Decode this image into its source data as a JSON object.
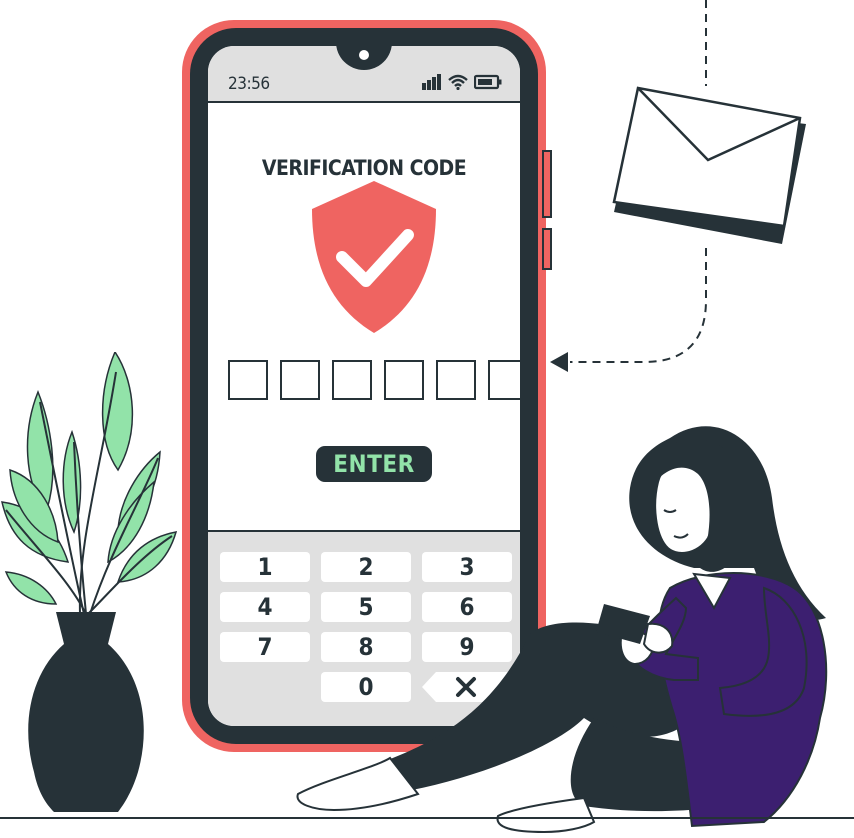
{
  "phone": {
    "status_bar": {
      "time": "23:56"
    },
    "screen_title": "VERIFICATION CODE",
    "code_boxes": [
      "",
      "",
      "",
      "",
      "",
      ""
    ],
    "enter_label": "ENTER",
    "keypad": {
      "keys": [
        "1",
        "2",
        "3",
        "4",
        "5",
        "6",
        "7",
        "8",
        "9",
        "0"
      ]
    }
  },
  "colors": {
    "phone_frame": "#ef6461",
    "dark": "#263238",
    "enter_text": "#92e3a9",
    "plant_leaves": "#92e3a9",
    "sweater": "#3c1f70",
    "screen_gray": "#e0e0e0"
  },
  "icons": [
    "signal-icon",
    "wifi-icon",
    "battery-icon",
    "shield-check-icon",
    "backspace-icon",
    "envelope-icon",
    "arrow-left-icon"
  ]
}
